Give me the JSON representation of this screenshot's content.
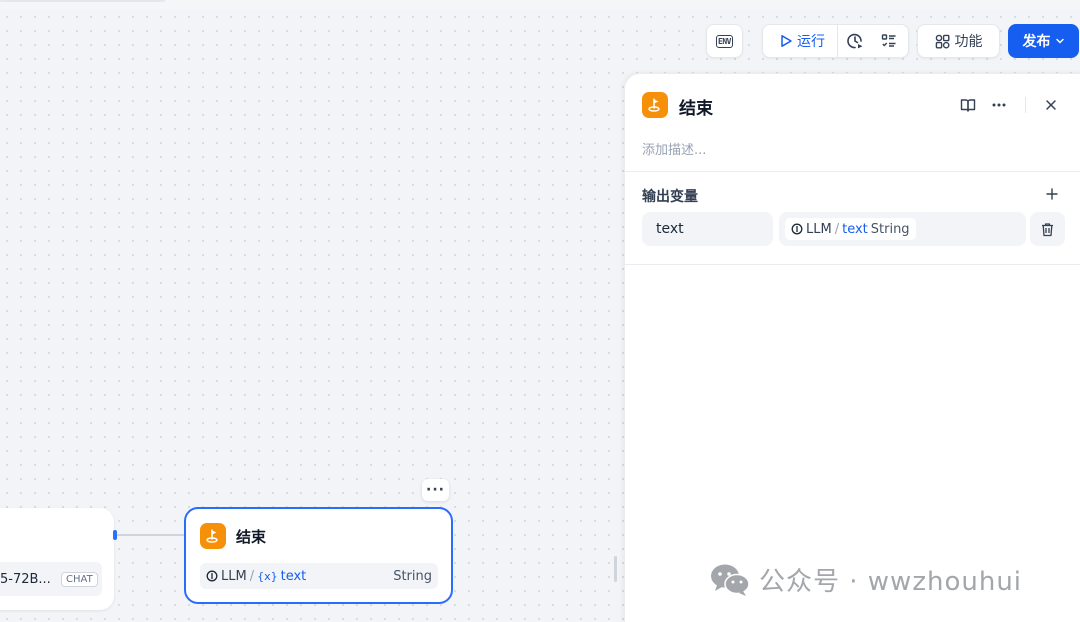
{
  "toolbar": {
    "env_label": "ENV",
    "run_label": "运行",
    "function_label": "功能",
    "publish_label": "发布"
  },
  "canvas": {
    "llm_node": {
      "model_name": "5-72B...",
      "mode_badge": "CHAT"
    },
    "end_node": {
      "title": "结束",
      "more_label": "···",
      "output": {
        "source": "LLM",
        "separator": "/",
        "var_prefix": "{x}",
        "name": "text",
        "type": "String"
      }
    }
  },
  "panel": {
    "title": "结束",
    "description_placeholder": "添加描述...",
    "section_title": "输出变量",
    "variables": [
      {
        "name": "text",
        "source": "LLM",
        "separator": "/",
        "ref_name": "text",
        "type": "String"
      }
    ]
  },
  "watermark": {
    "text": "公众号 · wwzhouhui"
  },
  "colors": {
    "accent": "#155eef",
    "end_icon": "#f79009",
    "node_border": "#296dff"
  }
}
